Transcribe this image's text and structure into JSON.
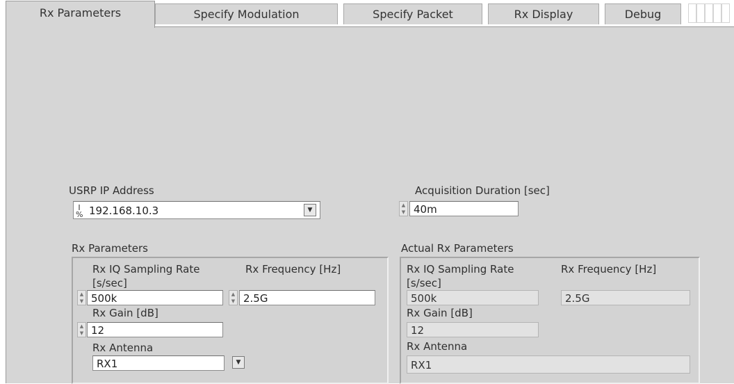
{
  "tabs": [
    {
      "label": "Rx Parameters",
      "active": true
    },
    {
      "label": "Specify Modulation",
      "active": false
    },
    {
      "label": "Specify Packet",
      "active": false
    },
    {
      "label": "Rx Display",
      "active": false
    },
    {
      "label": "Debug",
      "active": false
    }
  ],
  "usrp": {
    "label": "USRP IP Address",
    "value": "192.168.10.3"
  },
  "acquisition": {
    "label": "Acquisition Duration [sec]",
    "value": "40m"
  },
  "rx_params": {
    "title": "Rx Parameters",
    "sampling_rate_label": "Rx IQ Sampling Rate [s/sec]",
    "sampling_rate_value": "500k",
    "frequency_label": "Rx Frequency [Hz]",
    "frequency_value": "2.5G",
    "gain_label": "Rx Gain [dB]",
    "gain_value": "12",
    "antenna_label": "Rx Antenna",
    "antenna_value": "RX1"
  },
  "actual_rx_params": {
    "title": "Actual Rx Parameters",
    "sampling_rate_label": "Rx IQ Sampling Rate [s/sec]",
    "sampling_rate_value": "500k",
    "frequency_label": "Rx Frequency [Hz]",
    "frequency_value": "2.5G",
    "gain_label": "Rx Gain [dB]",
    "gain_value": "12",
    "antenna_label": "Rx Antenna",
    "antenna_value": "RX1"
  },
  "colors": {
    "panel": "#d6d6d6",
    "field": "#ffffff",
    "readonly_field": "#e2e2e2"
  },
  "icons": {
    "spin": "spin-arrows-icon",
    "dropdown": "dropdown-arrow-icon",
    "ip": "ip-address-icon"
  }
}
